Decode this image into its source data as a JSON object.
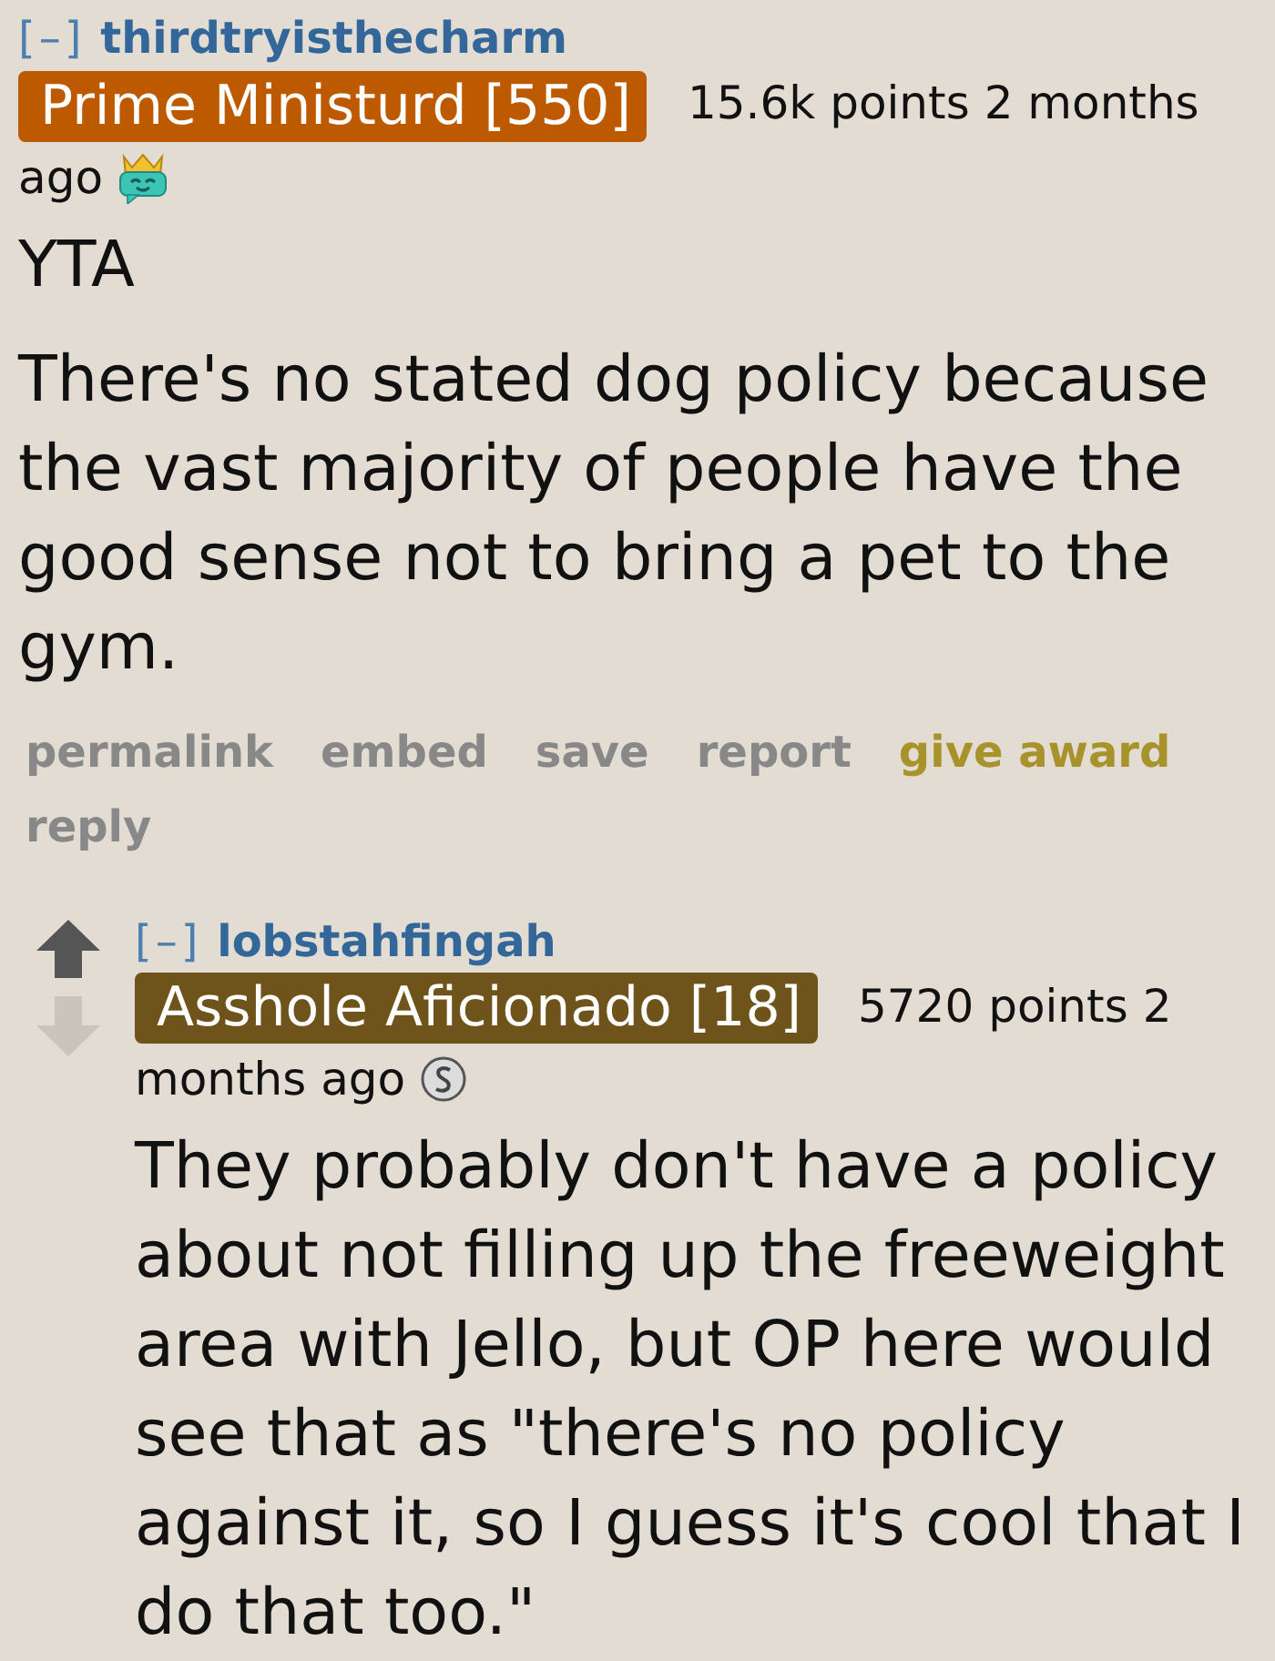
{
  "comments": [
    {
      "collapse": "[–]",
      "author": "thirdtryisthecharm",
      "flair": {
        "text": "Prime Ministurd [550]",
        "color": "#bd5a00"
      },
      "score": "15.6k points",
      "time": [
        "2 months",
        "ago"
      ],
      "award": {
        "kind": "crown"
      },
      "paragraphs": [
        "YTA",
        "There's no stated dog policy because the vast majority of people have the good sense not to bring a pet to the gym."
      ],
      "actions": [
        {
          "label": "permalink",
          "kind": "plain"
        },
        {
          "label": "embed",
          "kind": "plain"
        },
        {
          "label": "save",
          "kind": "plain"
        },
        {
          "label": "report",
          "kind": "plain"
        },
        {
          "label": "give award",
          "kind": "award"
        },
        {
          "label": "reply",
          "kind": "plain"
        }
      ],
      "children": [
        {
          "vote_arrows": true,
          "collapse": "[–]",
          "author": "lobstahfingah",
          "flair": {
            "text": "Asshole Aficionado [18]",
            "color": "#6e541b"
          },
          "score": "5720 points",
          "time": [
            "2",
            "months ago"
          ],
          "award": {
            "kind": "silver"
          },
          "paragraphs": [
            "They probably don't have a policy about not filling up the freeweight area with Jello, but OP here would see that as \"there's no policy against it, so I guess it's cool that I do that too.\""
          ]
        }
      ]
    }
  ]
}
